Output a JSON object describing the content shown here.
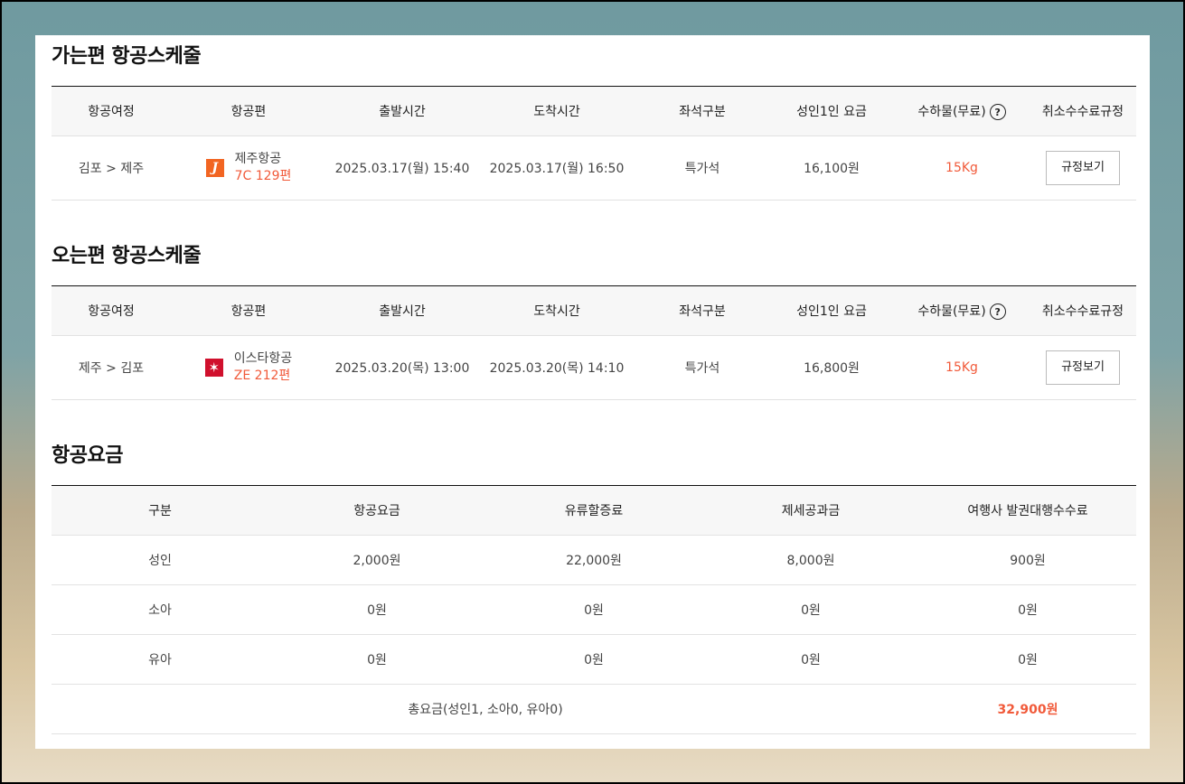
{
  "outbound": {
    "title": "가는편 항공스케줄",
    "headers": [
      "항공여정",
      "항공편",
      "출발시간",
      "도착시간",
      "좌석구분",
      "성인1인 요금",
      "수하물(무료)",
      "취소수수료규정"
    ],
    "help_glyph": "?",
    "row": {
      "route": "김포 > 제주",
      "airline": "제주항공",
      "logo_letter": "J",
      "flight": "7C 129편",
      "depart": "2025.03.17(월) 15:40",
      "arrive": "2025.03.17(월) 16:50",
      "seat": "특가석",
      "fare": "16,100원",
      "baggage": "15Kg",
      "button": "규정보기"
    }
  },
  "inbound": {
    "title": "오는편 항공스케줄",
    "headers": [
      "항공여정",
      "항공편",
      "출발시간",
      "도착시간",
      "좌석구분",
      "성인1인 요금",
      "수하물(무료)",
      "취소수수료규정"
    ],
    "help_glyph": "?",
    "row": {
      "route": "제주 > 김포",
      "airline": "이스타항공",
      "logo_letter": "✶",
      "flight": "ZE 212편",
      "depart": "2025.03.20(목) 13:00",
      "arrive": "2025.03.20(목) 14:10",
      "seat": "특가석",
      "fare": "16,800원",
      "baggage": "15Kg",
      "button": "규정보기"
    }
  },
  "fare": {
    "title": "항공요금",
    "headers": [
      "구분",
      "항공요금",
      "유류할증료",
      "제세공과금",
      "여행사 발권대행수수료"
    ],
    "rows": [
      [
        "성인",
        "2,000원",
        "22,000원",
        "8,000원",
        "900원"
      ],
      [
        "소아",
        "0원",
        "0원",
        "0원",
        "0원"
      ],
      [
        "유아",
        "0원",
        "0원",
        "0원",
        "0원"
      ]
    ],
    "total_label": "총요금(성인1, 소아0, 유아0)",
    "total_value": "32,900원"
  }
}
